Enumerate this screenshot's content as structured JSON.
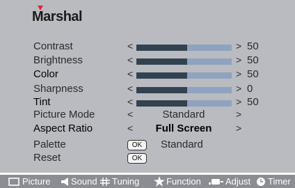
{
  "brand": "Marshal",
  "sliders": [
    {
      "label": "Contrast",
      "value": "50",
      "level_percent": 53
    },
    {
      "label": "Brightness",
      "value": "50",
      "level_percent": 53
    },
    {
      "label": "Color",
      "value": "50",
      "level_percent": 53
    },
    {
      "label": "Sharpness",
      "value": "0",
      "level_percent": 53
    },
    {
      "label": "Tint",
      "value": "50",
      "level_percent": 53
    }
  ],
  "options": [
    {
      "label": "Picture Mode",
      "value": "Standard"
    },
    {
      "label": "Aspect Ratio",
      "value": "Full Screen"
    }
  ],
  "arrow_left": "<",
  "arrow_right": ">",
  "palette": {
    "label": "Palette",
    "ok": "OK",
    "value": "Standard"
  },
  "reset": {
    "label": "Reset",
    "ok": "OK"
  },
  "footer": {
    "picture": "Picture",
    "sound": "Sound",
    "tuning": "Tuning",
    "function": "Function",
    "adjust": "Adjust",
    "timer": "Timer"
  },
  "icons": [
    "picture-icon",
    "speaker-icon",
    "grid-icon",
    "star-icon",
    "adjust-icon",
    "clock-icon"
  ]
}
